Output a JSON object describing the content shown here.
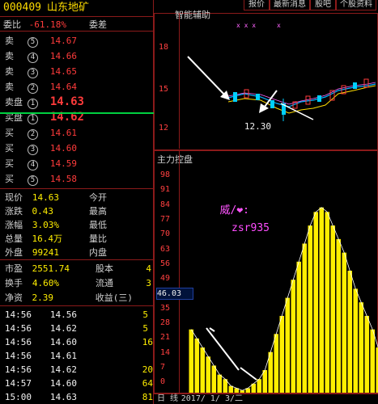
{
  "header": {
    "code": "000409",
    "name": "山东地矿",
    "weibi_label": "委比",
    "weibi_value": "-61.18%",
    "weicha_label": "委差"
  },
  "tabs": [
    "个股资料",
    "股吧",
    "最新消息",
    "报价"
  ],
  "order_book": {
    "sell": [
      {
        "label": "卖",
        "n": "5",
        "price": "14.67"
      },
      {
        "label": "卖",
        "n": "4",
        "price": "14.66"
      },
      {
        "label": "卖",
        "n": "3",
        "price": "14.65"
      },
      {
        "label": "卖",
        "n": "2",
        "price": "14.64"
      },
      {
        "label": "卖盘",
        "n": "1",
        "price": "14.63"
      }
    ],
    "buy": [
      {
        "label": "买盘",
        "n": "1",
        "price": "14.62"
      },
      {
        "label": "买",
        "n": "2",
        "price": "14.61"
      },
      {
        "label": "买",
        "n": "3",
        "price": "14.60"
      },
      {
        "label": "买",
        "n": "4",
        "price": "14.59"
      },
      {
        "label": "买",
        "n": "5",
        "price": "14.58"
      }
    ]
  },
  "stats": [
    {
      "label": "现价",
      "value": "14.63",
      "label2": "今开"
    },
    {
      "label": "涨跌",
      "value": "0.43",
      "label2": "最高"
    },
    {
      "label": "涨幅",
      "value": "3.03%",
      "label2": "最低"
    },
    {
      "label": "总量",
      "value": "16.4万",
      "label2": "量比"
    },
    {
      "label": "外盘",
      "value": "99241",
      "label2": "内盘"
    }
  ],
  "stats2": [
    {
      "label": "市盈",
      "value": "2551.74",
      "label2": "股本",
      "right": "4"
    },
    {
      "label": "换手",
      "value": "4.60%",
      "label2": "流通",
      "right": "3"
    },
    {
      "label": "净资",
      "value": "2.39",
      "label2": "收益(三)",
      "right": ""
    }
  ],
  "trades": [
    {
      "time": "14:56",
      "price": "14.56",
      "vol": "5"
    },
    {
      "time": "14:56",
      "price": "14.62",
      "vol": "5"
    },
    {
      "time": "14:56",
      "price": "14.60",
      "vol": "16"
    },
    {
      "time": "14:56",
      "price": "14.61",
      "vol": ""
    },
    {
      "time": "14:56",
      "price": "14.62",
      "vol": "20"
    },
    {
      "time": "14:57",
      "price": "14.60",
      "vol": "64"
    },
    {
      "time": "15:00",
      "price": "14.63",
      "vol": "81"
    }
  ],
  "kline": {
    "label": "智能辅助",
    "y_labels": [
      "18",
      "15",
      "12"
    ],
    "annotation": "12.30"
  },
  "main_panel": {
    "label": "主力控盘",
    "y_labels": [
      "98",
      "91",
      "84",
      "77",
      "70",
      "63",
      "56",
      "49",
      "42",
      "35",
      "28",
      "21",
      "14",
      "7",
      "0"
    ],
    "current_value": "46.03",
    "watermark1": "威/❤:",
    "watermark2": "zsr935",
    "date_label": "日 线",
    "date_value": "2017/ 1/ 3/二"
  },
  "chart_data": {
    "type": "bar",
    "title": "主力控盘",
    "ylim": [
      0,
      98
    ],
    "values": [
      28,
      24,
      20,
      16,
      12,
      8,
      6,
      3,
      2,
      1,
      2,
      4,
      6,
      10,
      18,
      26,
      34,
      42,
      50,
      58,
      66,
      74,
      80,
      82,
      80,
      74,
      68,
      62,
      54,
      46,
      40,
      34,
      28,
      20
    ]
  },
  "colors": {
    "bar": "#ffee00",
    "ma": "#00b0ff",
    "frame": "#8b1a1a",
    "axis": "#ff4040"
  }
}
